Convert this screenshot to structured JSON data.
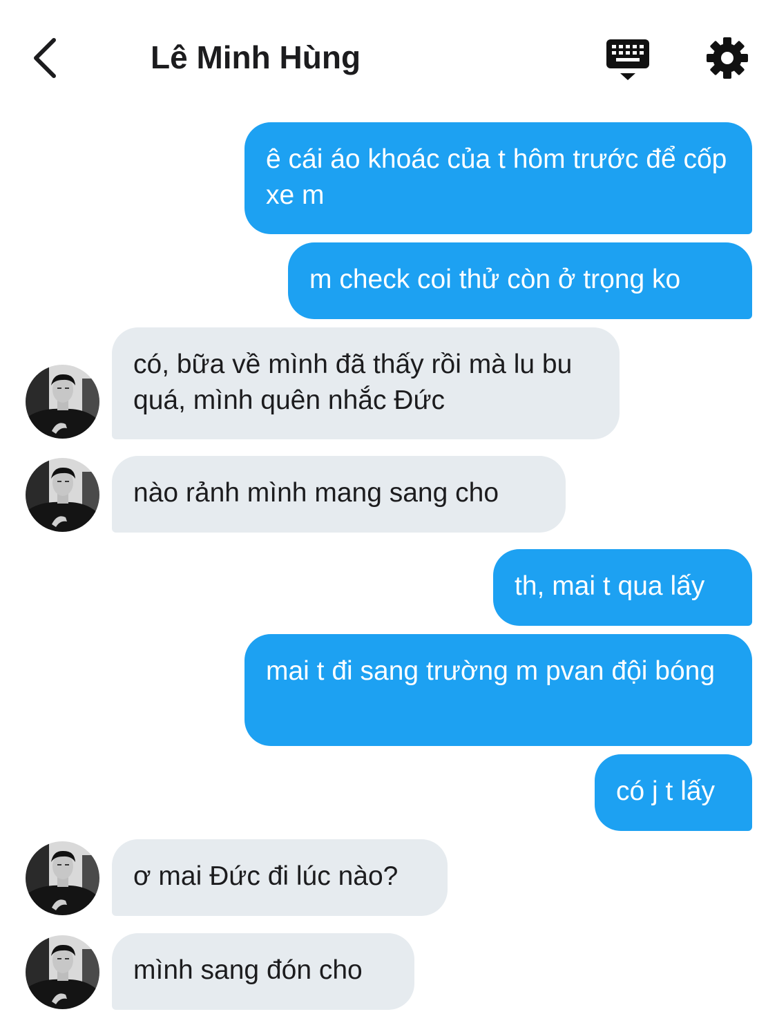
{
  "header": {
    "back_icon": "chevron-left-icon",
    "contact_name": "Lê Minh Hùng",
    "keyboard_icon": "keyboard-icon",
    "settings_icon": "gear-icon"
  },
  "colors": {
    "outgoing_bubble": "#1da1f2",
    "incoming_bubble": "#e6ebef",
    "title_text": "#1c1c1e"
  },
  "messages": [
    {
      "direction": "outgoing",
      "text": "ê cái áo khoác của t hôm trước để cốp xe m"
    },
    {
      "direction": "outgoing",
      "text": "m check coi thử còn ở trọng ko"
    },
    {
      "direction": "incoming",
      "text": "có, bữa về mình đã thấy rồi mà lu bu quá, mình quên nhắc Đức"
    },
    {
      "direction": "incoming",
      "text": "nào rảnh mình mang sang cho"
    },
    {
      "direction": "outgoing",
      "text": "th, mai t qua lấy"
    },
    {
      "direction": "outgoing",
      "text": "mai t đi sang trường m pvan đội bóng"
    },
    {
      "direction": "outgoing",
      "text": "có j t lấy"
    },
    {
      "direction": "incoming",
      "text": "ơ mai Đức đi lúc nào?"
    },
    {
      "direction": "incoming",
      "text": "mình sang đón cho"
    }
  ]
}
